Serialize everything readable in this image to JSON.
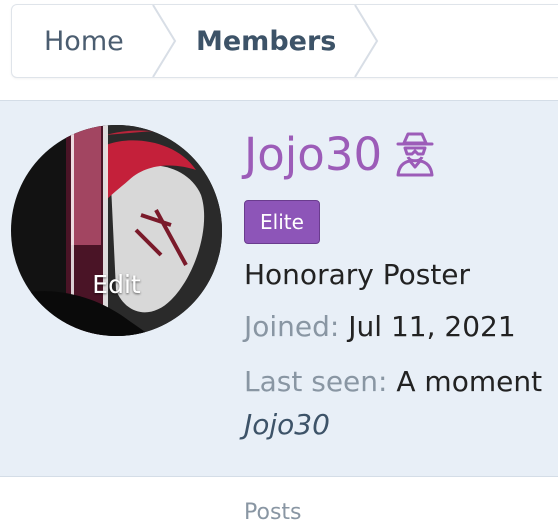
{
  "breadcrumb": {
    "items": [
      {
        "label": "Home"
      },
      {
        "label": "Members"
      }
    ]
  },
  "profile": {
    "avatar_edit_label": "Edit",
    "username": "Jojo30",
    "badge": "Elite",
    "user_title": "Honorary Poster",
    "joined_label": "Joined:",
    "joined_value": "Jul 11, 2021",
    "last_seen_label": "Last seen:",
    "last_seen_value": "A moment",
    "last_seen_user": "Jojo30",
    "icons": {
      "username_icon": "incognito-icon"
    }
  },
  "stats": {
    "posts_label": "Posts"
  },
  "colors": {
    "accent": "#9c5cb8",
    "badge": "#8d55b8",
    "panel": "#e8eff7"
  }
}
